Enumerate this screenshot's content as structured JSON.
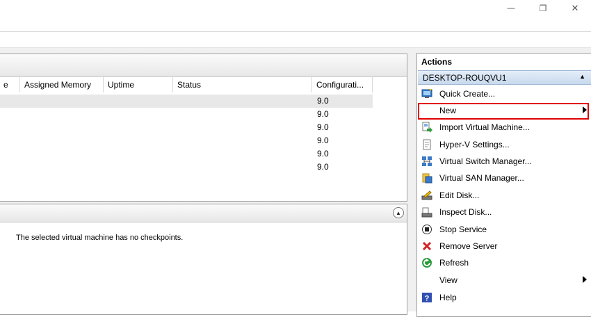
{
  "window": {
    "min_glyph": "—",
    "restore_glyph": "❐",
    "close_glyph": "✕"
  },
  "vm_list": {
    "columns": [
      "e",
      "Assigned Memory",
      "Uptime",
      "Status",
      "Configurati..."
    ],
    "config_values": [
      "9.0",
      "9.0",
      "9.0",
      "9.0",
      "9.0",
      "9.0"
    ]
  },
  "checkpoints": {
    "collapse_glyph": "▲",
    "empty_text": "The selected virtual machine has no checkpoints."
  },
  "actions": {
    "title": "Actions",
    "section": "DESKTOP-ROUQVU1",
    "section_arrow": "▲",
    "items": [
      {
        "label": "Quick Create...",
        "icon": "quick-create-icon"
      },
      {
        "label": "New",
        "icon": "none",
        "submenu": true
      },
      {
        "label": "Import Virtual Machine...",
        "icon": "import-vm-icon"
      },
      {
        "label": "Hyper-V Settings...",
        "icon": "settings-doc-icon"
      },
      {
        "label": "Virtual Switch Manager...",
        "icon": "switch-manager-icon"
      },
      {
        "label": "Virtual SAN Manager...",
        "icon": "san-manager-icon"
      },
      {
        "label": "Edit Disk...",
        "icon": "edit-disk-icon"
      },
      {
        "label": "Inspect Disk...",
        "icon": "inspect-disk-icon"
      },
      {
        "label": "Stop Service",
        "icon": "stop-service-icon"
      },
      {
        "label": "Remove Server",
        "icon": "remove-x-icon"
      },
      {
        "label": "Refresh",
        "icon": "refresh-icon"
      },
      {
        "label": "View",
        "icon": "none",
        "submenu": true
      },
      {
        "label": "Help",
        "icon": "help-icon"
      }
    ]
  },
  "colors": {
    "highlight_border": "#e00000",
    "remove_red": "#d42020",
    "refresh_green": "#2a9a3a",
    "help_blue": "#3050b0"
  }
}
